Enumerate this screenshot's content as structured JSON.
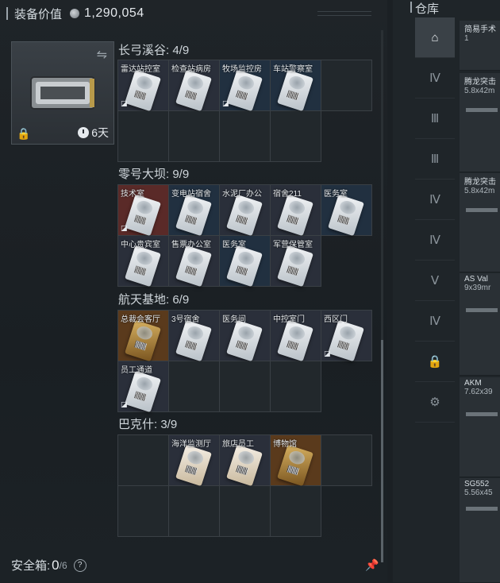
{
  "header": {
    "title": "装备价值",
    "value": "1,290,054"
  },
  "case": {
    "timer": "6天"
  },
  "sections": [
    {
      "title": "长弓溪谷: 4/9",
      "cards": [
        {
          "label": "雷达站控室",
          "color": "dark",
          "tag": "◪"
        },
        {
          "label": "检查站病房",
          "color": "dark",
          "tag": ""
        },
        {
          "label": "牧场监控房",
          "color": "blue",
          "tag": "◪"
        },
        {
          "label": "车站警察室",
          "color": "blue",
          "tag": ""
        }
      ]
    },
    {
      "title": "零号大坝: 9/9",
      "cards": [
        {
          "label": "技术室",
          "color": "red",
          "tag": "◪"
        },
        {
          "label": "变电站宿舍",
          "color": "blue",
          "tag": ""
        },
        {
          "label": "水泥厂办公",
          "color": "dark",
          "tag": ""
        },
        {
          "label": "宿舍211",
          "color": "dark",
          "tag": ""
        },
        {
          "label": "医务室",
          "color": "blue",
          "tag": ""
        },
        {
          "label": "中心贵宾室",
          "color": "dark",
          "tag": ""
        },
        {
          "label": "售票办公室",
          "color": "dark",
          "tag": ""
        },
        {
          "label": "医务室",
          "color": "blue",
          "tag": ""
        },
        {
          "label": "军营保管室",
          "color": "dark",
          "tag": ""
        }
      ]
    },
    {
      "title": "航天基地: 6/9",
      "cards": [
        {
          "label": "总裁会客厅",
          "color": "gold",
          "tag": ""
        },
        {
          "label": "3号宿舍",
          "color": "dark",
          "tag": ""
        },
        {
          "label": "医务间",
          "color": "dark",
          "tag": ""
        },
        {
          "label": "中控室门",
          "color": "dark",
          "tag": ""
        },
        {
          "label": "西区门",
          "color": "dark",
          "tag": "◪"
        },
        {
          "label": "员工通道",
          "color": "dark",
          "tag": "◪"
        }
      ]
    },
    {
      "title": "巴克什: 3/9",
      "cards": [
        {
          "label": "海洋监测厅",
          "color": "dark",
          "tag": ""
        },
        {
          "label": "旅店员工",
          "color": "dark",
          "tag": ""
        },
        {
          "label": "博物馆",
          "color": "gold",
          "tag": ""
        }
      ]
    }
  ],
  "safebox": {
    "label": "安全箱:",
    "count": "0",
    "capacity": "/6"
  },
  "warehouse": {
    "title": "仓库",
    "sidebar": [
      "home-icon",
      "tier4-icon",
      "tier3-icon",
      "tier3b-icon",
      "tier4b-icon",
      "tier4c-icon",
      "tier5-icon",
      "tier4d-icon",
      "lock-icon",
      "gear-icon"
    ],
    "items": [
      {
        "name": "简易手术",
        "sub": "1"
      },
      {
        "name": "腾龙突击",
        "sub": "5.8x42m"
      },
      {
        "name": "腾龙突击",
        "sub": "5.8x42m"
      },
      {
        "name": "AS Val",
        "sub": "9x39mr"
      },
      {
        "name": "AKM",
        "sub": "7.62x39"
      },
      {
        "name": "SG552",
        "sub": "5.56x45"
      }
    ]
  }
}
